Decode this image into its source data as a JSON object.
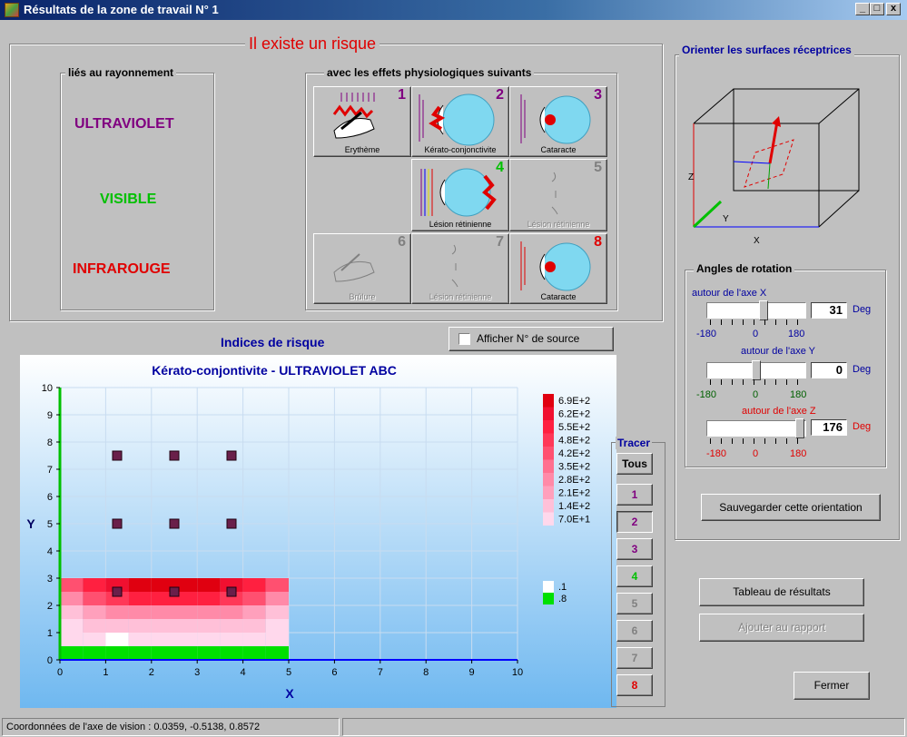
{
  "window": {
    "title": "Résultats de la zone de travail N° 1",
    "minimize": "_",
    "maximize": "□",
    "close": "x"
  },
  "risk_title": "Il existe un risque",
  "radiation_group": {
    "title": "liés au rayonnement",
    "uv": "ULTRAVIOLET",
    "visible": "VISIBLE",
    "ir": "INFRAROUGE"
  },
  "effects_group": {
    "title": "avec les effets physiologiques suivants",
    "tiles": [
      {
        "num": "1",
        "label": "Erythème"
      },
      {
        "num": "2",
        "label": "Kérato-conjonctivite"
      },
      {
        "num": "3",
        "label": "Cataracte"
      },
      {
        "num": "4",
        "label": "Lésion rétinienne"
      },
      {
        "num": "5",
        "label": "Lésion rétinienne"
      },
      {
        "num": "6",
        "label": "Brûlure"
      },
      {
        "num": "7",
        "label": "Lésion rétinienne"
      },
      {
        "num": "8",
        "label": "Cataracte"
      }
    ]
  },
  "orient": {
    "title": "Orienter les surfaces réceptrices",
    "axis_x": "X",
    "axis_y": "Y",
    "axis_z": "Z"
  },
  "angles": {
    "title": "Angles de rotation",
    "unit": "Deg",
    "x": {
      "label": "autour de l'axe X",
      "value": "31",
      "min": "-180",
      "mid": "0",
      "max": "180",
      "fraction": 0.586
    },
    "y": {
      "label": "autour de l'axe Y",
      "value": "0",
      "min": "-180",
      "mid": "0",
      "max": "180",
      "fraction": 0.5
    },
    "z": {
      "label": "autour de l'axe Z",
      "value": "176",
      "min": "-180",
      "mid": "0",
      "max": "180",
      "fraction": 0.989
    }
  },
  "buttons": {
    "save_orientation": "Sauvegarder cette orientation",
    "results_table": "Tableau de résultats",
    "add_report": "Ajouter au rapport",
    "close": "Fermer"
  },
  "indices_title": "Indices de risque",
  "show_source": "Afficher N° de source",
  "tracer": {
    "title": "Tracer",
    "all": "Tous",
    "items": [
      "1",
      "2",
      "3",
      "4",
      "5",
      "6",
      "7",
      "8"
    ]
  },
  "status": {
    "text": "Coordonnées de l'axe de vision : 0.0359, -0.5138, 0.8572"
  },
  "colors": {
    "uv": "#800080",
    "visible": "#00c000",
    "ir": "#e00000",
    "accent_blue": "#0000a0"
  },
  "chart_data": {
    "type": "heatmap",
    "title": "Kérato-conjontivite - ULTRAVIOLET ABC",
    "xlabel": "X",
    "ylabel": "Y",
    "xlim": [
      0,
      10
    ],
    "ylim": [
      0,
      10
    ],
    "xticks": [
      "0",
      "1",
      "2",
      "3",
      "4",
      "5",
      "6",
      "7",
      "8",
      "9",
      "10"
    ],
    "yticks": [
      "0",
      "1",
      "2",
      "3",
      "4",
      "5",
      "6",
      "7",
      "8",
      "9",
      "10"
    ],
    "legend": [
      "6.9E+2",
      "6.2E+2",
      "5.5E+2",
      "4.8E+2",
      "4.2E+2",
      "3.5E+2",
      "2.8E+2",
      "2.1E+2",
      "1.4E+2",
      "7.0E+1"
    ],
    "legend_small": [
      ".1",
      ".8"
    ],
    "cell_size": 0.5,
    "rows": [
      {
        "y": 2.5,
        "values": [
          390,
          560,
          620,
          690,
          690,
          690,
          690,
          620,
          560,
          390
        ]
      },
      {
        "y": 2.0,
        "values": [
          280,
          420,
          480,
          560,
          560,
          560,
          560,
          480,
          420,
          280
        ]
      },
      {
        "y": 1.5,
        "values": [
          140,
          210,
          280,
          280,
          280,
          280,
          280,
          280,
          210,
          140
        ]
      },
      {
        "y": 1.0,
        "values": [
          70,
          140,
          140,
          140,
          140,
          140,
          140,
          140,
          140,
          70
        ]
      },
      {
        "y": 0.5,
        "values": [
          30,
          70,
          0,
          70,
          70,
          70,
          70,
          70,
          70,
          30
        ]
      },
      {
        "y": 0.0,
        "values": [
          -1,
          -1,
          -1,
          -1,
          -1,
          -1,
          -1,
          -1,
          -1,
          -1
        ]
      }
    ],
    "sources": [
      {
        "x": 1.25,
        "y": 7.5
      },
      {
        "x": 2.5,
        "y": 7.5
      },
      {
        "x": 3.75,
        "y": 7.5
      },
      {
        "x": 1.25,
        "y": 5.0
      },
      {
        "x": 2.5,
        "y": 5.0
      },
      {
        "x": 3.75,
        "y": 5.0
      },
      {
        "x": 1.25,
        "y": 2.5
      },
      {
        "x": 2.5,
        "y": 2.5
      },
      {
        "x": 3.75,
        "y": 2.5
      }
    ]
  }
}
